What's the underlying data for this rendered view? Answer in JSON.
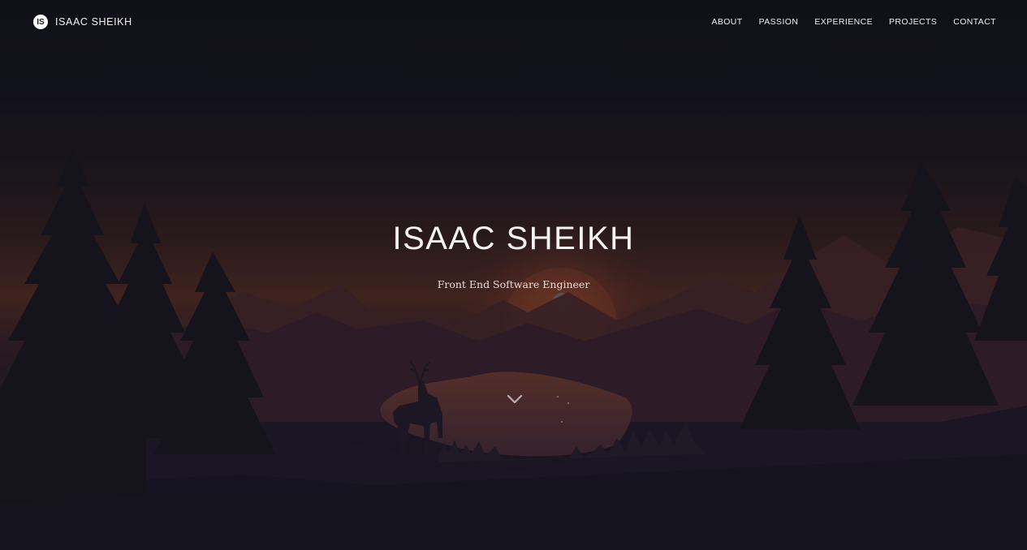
{
  "header": {
    "logo_initials": "IS",
    "brand_name": "ISAAC SHEIKH",
    "nav": [
      {
        "label": "ABOUT"
      },
      {
        "label": "PASSION"
      },
      {
        "label": "EXPERIENCE"
      },
      {
        "label": "PROJECTS"
      },
      {
        "label": "CONTACT"
      }
    ]
  },
  "hero": {
    "title": "ISAAC SHEIKH",
    "subtitle": "Front End Software Engineer",
    "scroll_icon": "chevron-down-icon"
  },
  "colors": {
    "background": "#161421",
    "sunset": "#5a2f23",
    "text": "#f5f3f2"
  }
}
